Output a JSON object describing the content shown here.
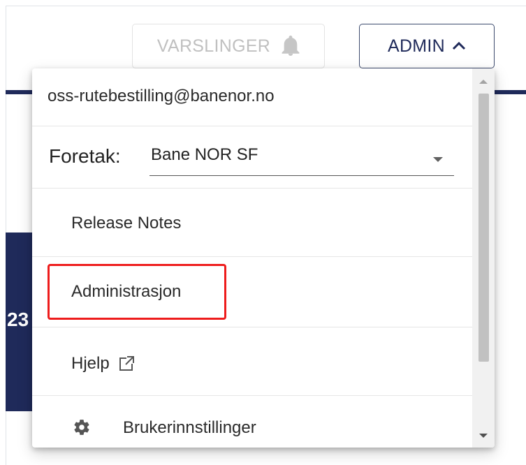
{
  "header": {
    "notifications_label": "VARSLINGER",
    "notifications_icon": "bell-icon",
    "admin_label": "ADMIN",
    "admin_icon": "chevron-up-icon"
  },
  "background": {
    "card_number": "23"
  },
  "menu": {
    "email": "oss-rutebestilling@banenor.no",
    "company_label": "Foretak:",
    "company_value": "Bane NOR SF",
    "items": [
      {
        "label": "Release Notes"
      },
      {
        "label": "Administrasjon",
        "highlighted": true
      },
      {
        "label": "Hjelp",
        "icon": "external-link-icon"
      },
      {
        "label": "Brukerinnstillinger",
        "icon": "gear-icon"
      }
    ]
  },
  "colors": {
    "brand_navy": "#1f2a5a",
    "highlight_red": "#ee1c1c"
  }
}
